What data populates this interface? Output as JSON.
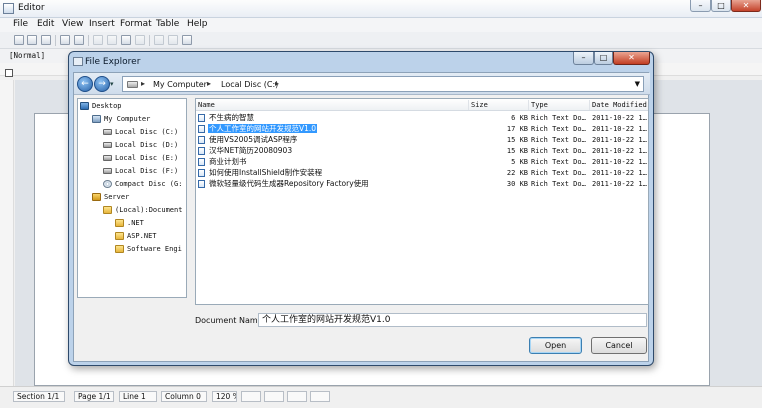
{
  "window": {
    "title": "Editor"
  },
  "menu": [
    "File",
    "Edit",
    "View",
    "Insert",
    "Format",
    "Table",
    "Help"
  ],
  "style_box": "[Normal]",
  "status": [
    "Section 1/1",
    "Page 1/1",
    "Line 1",
    "Column 0",
    "120 %"
  ],
  "dialog": {
    "title": "File Explorer",
    "address": [
      "My Computer",
      "Local Disc (C:)"
    ],
    "tree": [
      {
        "label": "Desktop",
        "icon": "desktop-icon"
      },
      {
        "label": "My Computer",
        "icon": "computer-icon"
      },
      {
        "label": "Local Disc (C:)",
        "icon": "drive-icon"
      },
      {
        "label": "Local Disc (D:)",
        "icon": "drive-icon"
      },
      {
        "label": "Local Disc (E:)",
        "icon": "drive-icon"
      },
      {
        "label": "Local Disc (F:)",
        "icon": "drive-icon"
      },
      {
        "label": "Compact Disc (G:",
        "icon": "cd-icon"
      },
      {
        "label": "Server",
        "icon": "server-icon"
      },
      {
        "label": "(Local):Document",
        "icon": "folder-icon"
      },
      {
        "label": ".NET",
        "icon": "folder-icon"
      },
      {
        "label": "ASP.NET",
        "icon": "folder-icon"
      },
      {
        "label": "Software Engi",
        "icon": "folder-icon"
      }
    ],
    "columns": {
      "name": "Name",
      "size": "Size",
      "type": "Type",
      "date": "Date Modified"
    },
    "files": [
      {
        "name": "不生病的智慧",
        "size": "6 KB",
        "type": "Rich Text Do…",
        "date": "2011-10-22 1…"
      },
      {
        "name": "个人工作室的网站开发规范V1.0",
        "size": "17 KB",
        "type": "Rich Text Do…",
        "date": "2011-10-22 1…"
      },
      {
        "name": "使用VS2005调试ASP程序",
        "size": "15 KB",
        "type": "Rich Text Do…",
        "date": "2011-10-22 1…"
      },
      {
        "name": "汉华NET简历20080903",
        "size": "15 KB",
        "type": "Rich Text Do…",
        "date": "2011-10-22 1…"
      },
      {
        "name": "商业计划书",
        "size": "5 KB",
        "type": "Rich Text Do…",
        "date": "2011-10-22 1…"
      },
      {
        "name": "如何使用InstallShield制作安装程",
        "size": "22 KB",
        "type": "Rich Text Do…",
        "date": "2011-10-22 1…"
      },
      {
        "name": "微软轻量级代码生成器Repository Factory使用",
        "size": "30 KB",
        "type": "Rich Text Do…",
        "date": "2011-10-22 1…"
      }
    ],
    "selected_index": 1,
    "document_name_label": "Document Name:",
    "document_name_value": "个人工作室的网站开发规范V1.0",
    "open_label": "Open",
    "cancel_label": "Cancel"
  }
}
